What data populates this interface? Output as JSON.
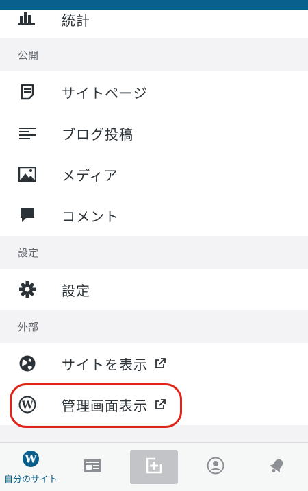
{
  "menu": {
    "stats_label": "統計",
    "section_publish": "公開",
    "pages_label": "サイトページ",
    "posts_label": "ブログ投稿",
    "media_label": "メディア",
    "comments_label": "コメント",
    "section_settings": "設定",
    "settings_label": "設定",
    "section_external": "外部",
    "view_site_label": "サイトを表示",
    "wp_admin_label": "管理画面表示"
  },
  "icons": {
    "stats": "stats-bar-icon",
    "pages": "page-icon",
    "posts": "posts-list-icon",
    "media": "image-icon",
    "comments": "comment-bubble-icon",
    "settings": "gear-icon",
    "view_site": "globe-icon",
    "wp_admin": "wordpress-icon",
    "external": "external-link-icon"
  },
  "bottom_nav": {
    "my_site_label": "自分のサイト"
  },
  "colors": {
    "accent": "#0a608c",
    "highlight": "#e0261b",
    "icon": "#2c3338"
  }
}
